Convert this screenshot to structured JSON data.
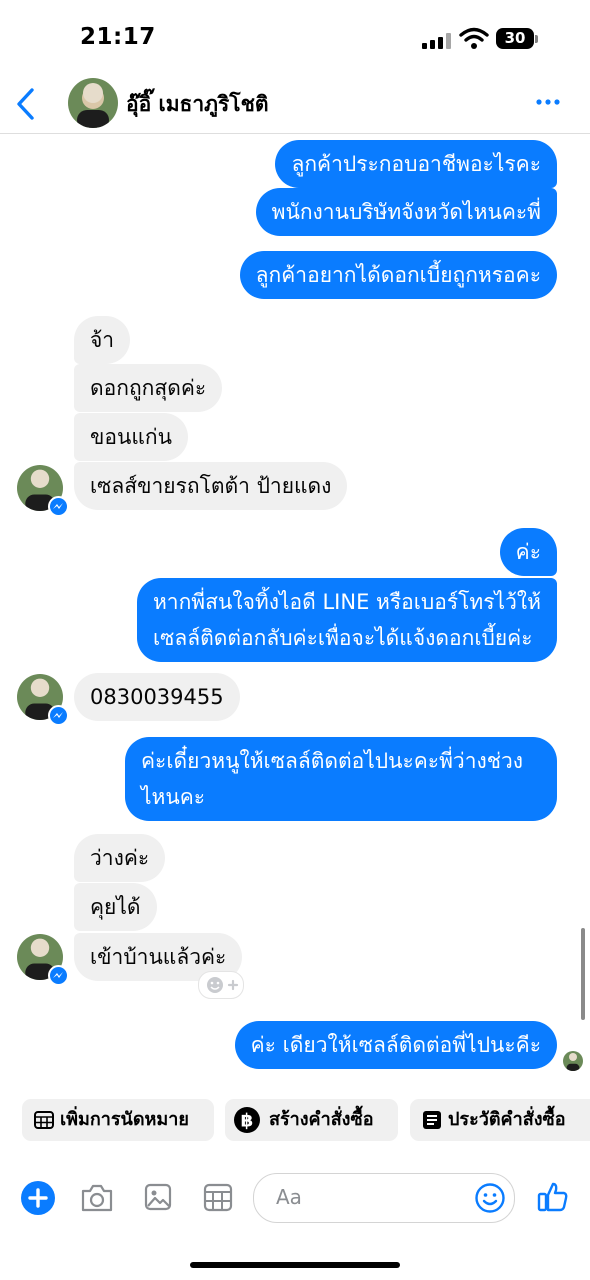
{
  "status_bar": {
    "time": "21:17",
    "battery": "30"
  },
  "header": {
    "contact_name": "อุ๊อิ๊ เมธาภูริโชติ"
  },
  "messages": {
    "s1": "ลูกค้าประกอบอาชีพอะไรคะ",
    "s2": "พนักงานบริษัทจังหวัดไหนคะพี่",
    "s3": "ลูกค้าอยากได้ดอกเบี้ยถูกหรอคะ",
    "r1": "จ้า",
    "r2": "ดอกถูกสุดค่ะ",
    "r3": "ขอนแก่น",
    "r4": "เซลส์ขายรถโตต้า ป้ายแดง",
    "s4": "ค่ะ",
    "s5_line1": "หากพี่สนใจทิ้งไอดี LINE หรือเบอร์โทรไว้ให้",
    "s5_line2": "เซลล์ติดต่อกลับค่ะเพื่อจะได้แจ้งดอกเบี้ยค่ะ",
    "r5": "0830039455",
    "s6_line1": "ค่ะเดี๋ยวหนูให้เซลล์ติดต่อไปนะคะพี่ว่างช่วง",
    "s6_line2": "ไหนคะ",
    "r6": "ว่างค่ะ",
    "r7": "คุยได้",
    "r8": "เข้าบ้านแล้วค่ะ",
    "s7": "ค่ะ เดียวให้เซลล์ติดต่อพี่ไปนะคีะ"
  },
  "quick_actions": {
    "appointment": "เพิ่มการนัดหมาย",
    "create_order": "สร้างคำสั่งซื้อ",
    "order_history": "ประวัติคำสั่งซื้อ"
  },
  "composer": {
    "placeholder": "Aa"
  },
  "colors": {
    "accent": "#0a7cff",
    "received_bubble": "#f0f0f0"
  }
}
